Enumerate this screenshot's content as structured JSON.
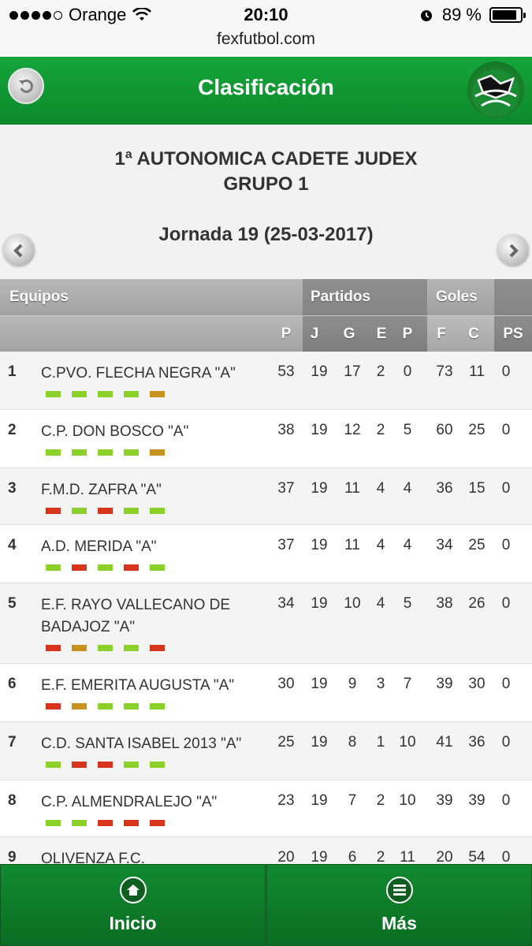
{
  "status": {
    "carrier": "Orange",
    "time": "20:10",
    "battery": "89 %",
    "url": "fexfutbol.com"
  },
  "header": {
    "title": "Clasificación"
  },
  "league": {
    "line1": "1ª AUTONOMICA CADETE JUDEX",
    "line2": "GRUPO 1",
    "jornada": "Jornada 19 (25-03-2017)"
  },
  "table": {
    "group_headers": {
      "teams": "Equipos",
      "matches": "Partidos",
      "goals": "Goles"
    },
    "columns": {
      "points": "P",
      "played": "J",
      "won": "G",
      "drawn": "E",
      "lost": "P",
      "for": "F",
      "against": "C",
      "ps": "PS"
    },
    "rows": [
      {
        "pos": "1",
        "team": "C.PVO. FLECHA NEGRA \"A\"",
        "p": "53",
        "j": "19",
        "g": "17",
        "e": "2",
        "l": "0",
        "f": "73",
        "c": "11",
        "ps": "0",
        "form": [
          "W",
          "W",
          "W",
          "W",
          "D"
        ]
      },
      {
        "pos": "2",
        "team": "C.P. DON BOSCO \"A\"",
        "p": "38",
        "j": "19",
        "g": "12",
        "e": "2",
        "l": "5",
        "f": "60",
        "c": "25",
        "ps": "0",
        "form": [
          "W",
          "W",
          "W",
          "W",
          "D"
        ]
      },
      {
        "pos": "3",
        "team": "F.M.D. ZAFRA \"A\"",
        "p": "37",
        "j": "19",
        "g": "11",
        "e": "4",
        "l": "4",
        "f": "36",
        "c": "15",
        "ps": "0",
        "form": [
          "L",
          "W",
          "L",
          "W",
          "W"
        ]
      },
      {
        "pos": "4",
        "team": "A.D. MERIDA \"A\"",
        "p": "37",
        "j": "19",
        "g": "11",
        "e": "4",
        "l": "4",
        "f": "34",
        "c": "25",
        "ps": "0",
        "form": [
          "W",
          "L",
          "W",
          "L",
          "W"
        ]
      },
      {
        "pos": "5",
        "team": "E.F. RAYO VALLECANO DE BADAJOZ \"A\"",
        "p": "34",
        "j": "19",
        "g": "10",
        "e": "4",
        "l": "5",
        "f": "38",
        "c": "26",
        "ps": "0",
        "form": [
          "L",
          "D",
          "W",
          "W",
          "L"
        ]
      },
      {
        "pos": "6",
        "team": "E.F. EMERITA AUGUSTA \"A\"",
        "p": "30",
        "j": "19",
        "g": "9",
        "e": "3",
        "l": "7",
        "f": "39",
        "c": "30",
        "ps": "0",
        "form": [
          "L",
          "D",
          "W",
          "W",
          "W"
        ]
      },
      {
        "pos": "7",
        "team": "C.D. SANTA ISABEL 2013 \"A\"",
        "p": "25",
        "j": "19",
        "g": "8",
        "e": "1",
        "l": "10",
        "f": "41",
        "c": "36",
        "ps": "0",
        "form": [
          "W",
          "L",
          "L",
          "W",
          "W"
        ]
      },
      {
        "pos": "8",
        "team": "C.P. ALMENDRALEJO \"A\"",
        "p": "23",
        "j": "19",
        "g": "7",
        "e": "2",
        "l": "10",
        "f": "39",
        "c": "39",
        "ps": "0",
        "form": [
          "W",
          "W",
          "L",
          "L",
          "L"
        ]
      },
      {
        "pos": "9",
        "team": "OLIVENZA F.C.",
        "p": "20",
        "j": "19",
        "g": "6",
        "e": "2",
        "l": "11",
        "f": "20",
        "c": "54",
        "ps": "0",
        "form": []
      }
    ]
  },
  "footer": {
    "home_label": "Inicio",
    "more_label": "Más"
  },
  "colors": {
    "brand_green": "#0c8a2c",
    "win": "#8cd12a",
    "loss": "#d8351e",
    "draw": "#c8921f"
  },
  "icons": {
    "back": "back-icon",
    "prev": "chevron-left-icon",
    "next": "chevron-right-icon",
    "home": "home-icon",
    "more": "menu-icon"
  }
}
